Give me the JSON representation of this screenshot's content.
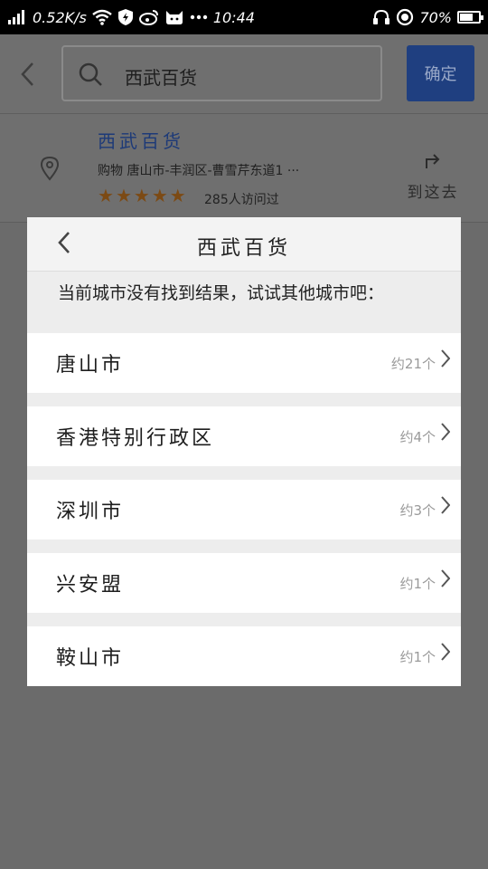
{
  "status_bar": {
    "speed": "0.52K/s",
    "time": "10:44",
    "battery": "70%",
    "battery_level": 0.7,
    "icons": [
      "signal-icon",
      "wifi-icon",
      "shield-icon",
      "weibo-icon",
      "cat-icon",
      "more-icon",
      "headset-icon",
      "circle-icon",
      "battery-icon"
    ]
  },
  "search": {
    "query": "西武百货",
    "confirm_label": "确定"
  },
  "result": {
    "name": "西武百货",
    "address": "购物  唐山市-丰润区-曹雪芹东道1 ···",
    "rating": 5,
    "visits": "285人访问过",
    "goto_label": "到这去"
  },
  "dialog": {
    "title": "西武百货",
    "message": "当前城市没有找到结果，试试其他城市吧：",
    "cities": [
      {
        "name": "唐山市",
        "count": "约21个"
      },
      {
        "name": "香港特别行政区",
        "count": "约4个"
      },
      {
        "name": "深圳市",
        "count": "约3个"
      },
      {
        "name": "兴安盟",
        "count": "约1个"
      },
      {
        "name": "鞍山市",
        "count": "约1个"
      }
    ]
  },
  "colors": {
    "overlay": "#6b6b6b",
    "confirm_button": "#1f3f80",
    "result_name": "#1d3a78",
    "star": "#7c4a14"
  }
}
